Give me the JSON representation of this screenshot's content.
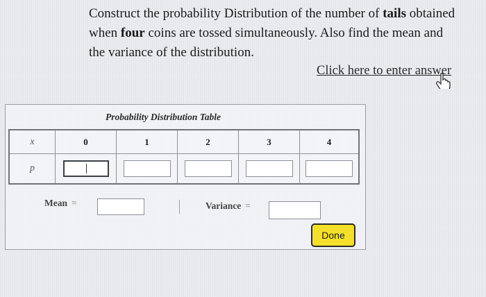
{
  "question": {
    "line1_pre": "Construct the probability Distribution of the number of ",
    "line1_bold": "tails",
    "line1_post": " obtained",
    "line2_pre": "when ",
    "line2_bold": "four",
    "line2_post": " coins are tossed simultaneously. Also find the mean and",
    "line3": "the variance of the distribution."
  },
  "link": {
    "text": "Click here to enter answer"
  },
  "table": {
    "title": "Probability Distribution Table",
    "x_label": "x",
    "p_label": "p",
    "x_values": [
      "0",
      "1",
      "2",
      "3",
      "4"
    ],
    "p_values": [
      "",
      "",
      "",
      "",
      ""
    ]
  },
  "mean": {
    "label": "Mean",
    "equals": "=",
    "value": ""
  },
  "variance": {
    "label": "Variance",
    "equals": "=",
    "value": ""
  },
  "done_button": {
    "label": "Done"
  },
  "colors": {
    "background": "#e9ebef",
    "done_button": "#f4e02a"
  }
}
